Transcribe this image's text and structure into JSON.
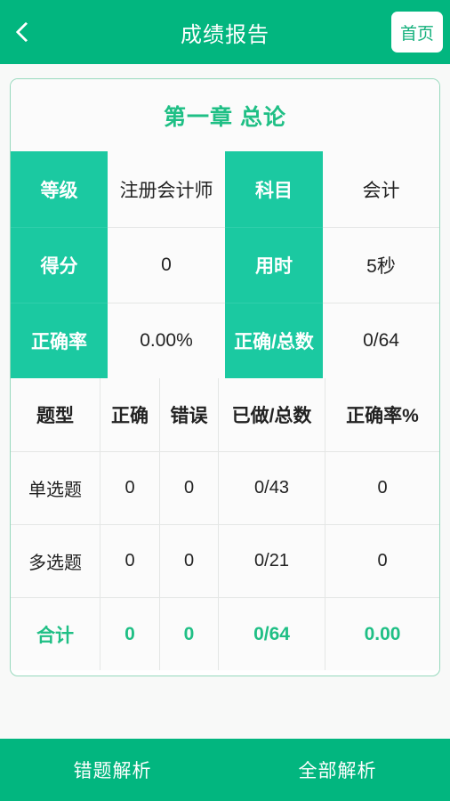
{
  "appbar": {
    "back_icon": "chevron-left-icon",
    "title": "成绩报告",
    "home_label": "首页"
  },
  "card": {
    "chapter_title": "第一章 总论",
    "info_rows": [
      [
        {
          "label": "等级",
          "value": "注册会计师"
        },
        {
          "label": "科目",
          "value": "会计"
        }
      ],
      [
        {
          "label": "得分",
          "value": "0"
        },
        {
          "label": "用时",
          "value": "5秒"
        }
      ],
      [
        {
          "label": "正确率",
          "value": "0.00%"
        },
        {
          "label": "正确/总数",
          "value": "0/64"
        }
      ]
    ],
    "question_table": {
      "headers": [
        "题型",
        "正确",
        "错误",
        "已做/总数",
        "正确率%"
      ],
      "rows": [
        [
          "单选题",
          "0",
          "0",
          "0/43",
          "0"
        ],
        [
          "多选题",
          "0",
          "0",
          "0/21",
          "0"
        ]
      ],
      "total_row": [
        "合计",
        "0",
        "0",
        "0/64",
        "0.00"
      ]
    }
  },
  "bottombar": {
    "actions": [
      {
        "label": "错题解析"
      },
      {
        "label": "全部解析"
      }
    ]
  },
  "colors": {
    "appbar_green": "#02b67f",
    "cell_green": "#1bc9a1",
    "accent_text_green": "#1fbf85",
    "page_bg": "#f8f9f8",
    "card_border": "#97d9bd"
  }
}
